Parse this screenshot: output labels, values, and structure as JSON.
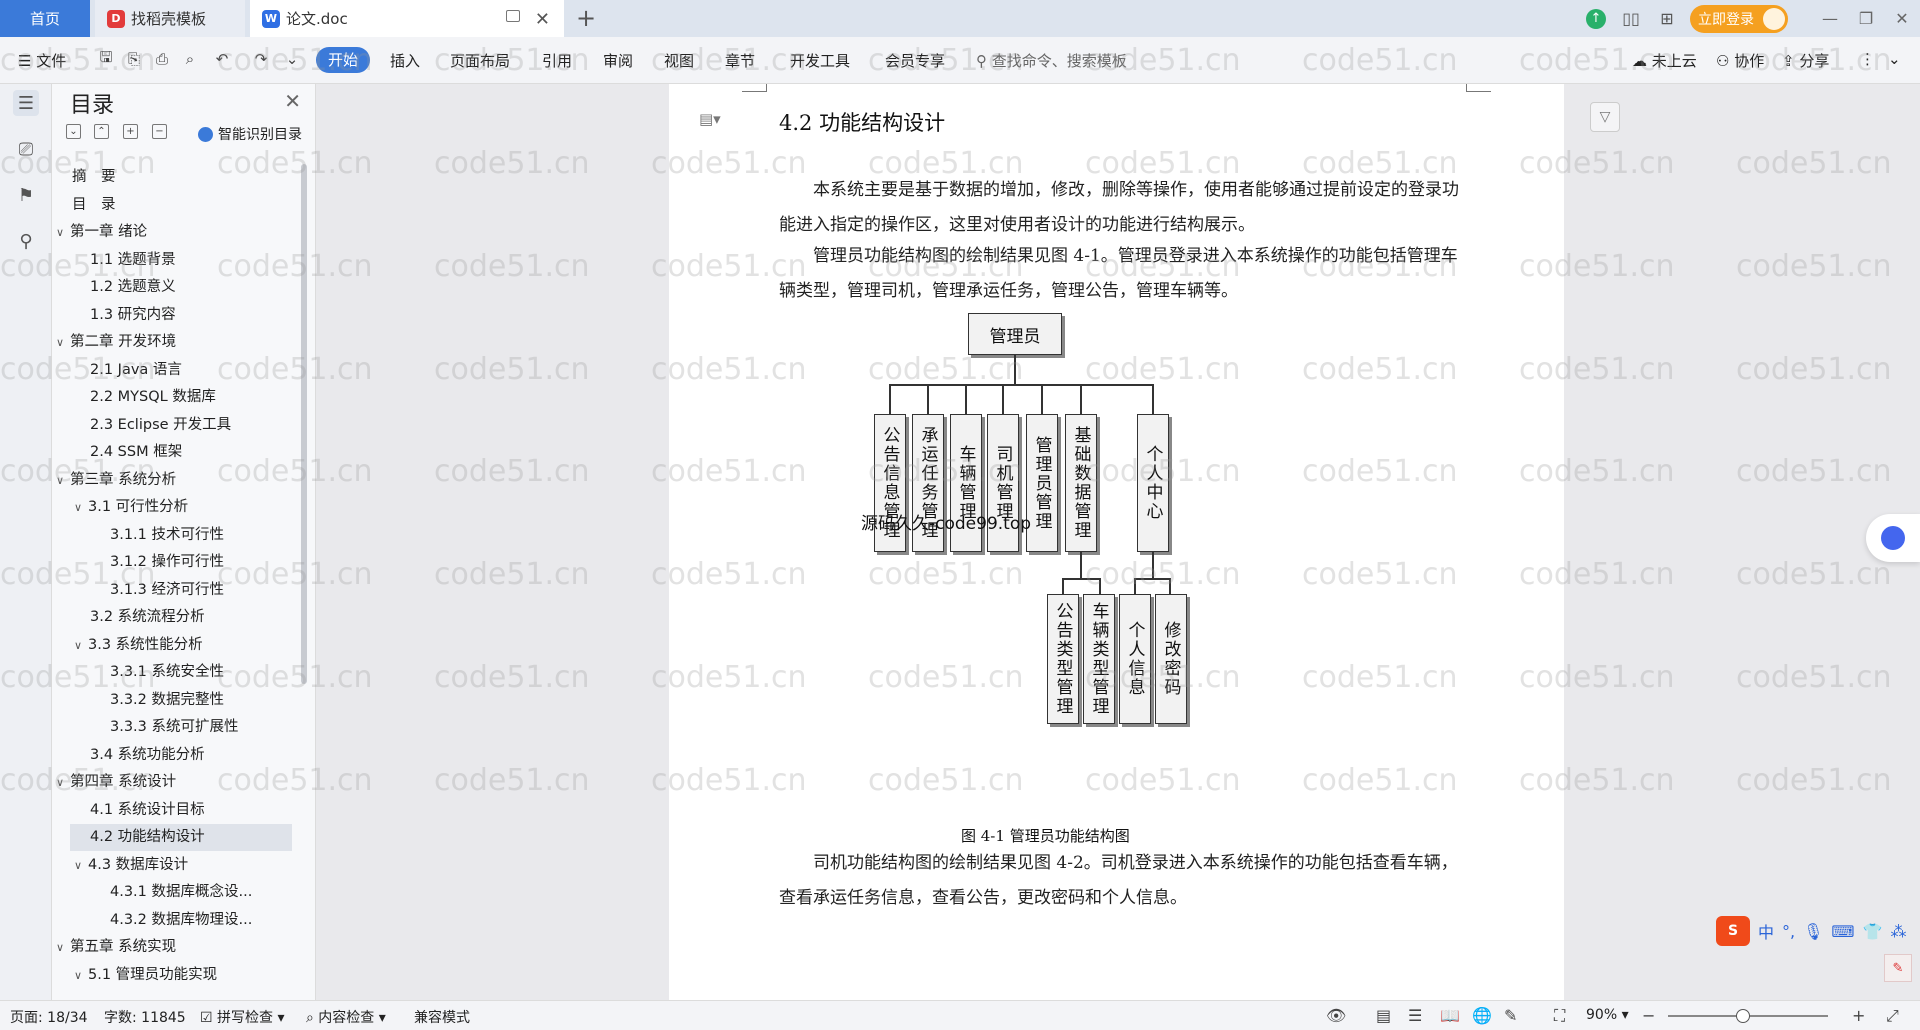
{
  "tabs": {
    "home": "首页",
    "template": "找稻壳模板",
    "doc": "论文.doc"
  },
  "titlebar": {
    "login": "立即登录"
  },
  "menubar": {
    "file": "文件",
    "items": [
      "开始",
      "插入",
      "页面布局",
      "引用",
      "审阅",
      "视图",
      "章节",
      "开发工具",
      "会员专享"
    ],
    "search_placeholder": "查找命令、搜索模板",
    "cloud": "未上云",
    "collab": "协作",
    "share": "分享"
  },
  "toc": {
    "title": "目录",
    "smart": "智能识别目录",
    "items": [
      {
        "text": "摘　要",
        "level": 1,
        "arrow": ""
      },
      {
        "text": "目　录",
        "level": 1,
        "arrow": ""
      },
      {
        "text": "第一章  绪论",
        "level": 1,
        "arrow": "∨"
      },
      {
        "text": "1.1  选题背景",
        "level": 2,
        "arrow": ""
      },
      {
        "text": "1.2  选题意义",
        "level": 2,
        "arrow": ""
      },
      {
        "text": "1.3  研究内容",
        "level": 2,
        "arrow": ""
      },
      {
        "text": "第二章  开发环境",
        "level": 1,
        "arrow": "∨"
      },
      {
        "text": "2.1 Java 语言",
        "level": 2,
        "arrow": ""
      },
      {
        "text": "2.2 MYSQL 数据库",
        "level": 2,
        "arrow": ""
      },
      {
        "text": "2.3 Eclipse 开发工具",
        "level": 2,
        "arrow": ""
      },
      {
        "text": "2.4 SSM 框架",
        "level": 2,
        "arrow": ""
      },
      {
        "text": "第三章  系统分析",
        "level": 1,
        "arrow": "∨"
      },
      {
        "text": "3.1 可行性分析",
        "level": 2,
        "arrow": "∨"
      },
      {
        "text": "3.1.1 技术可行性",
        "level": 3,
        "arrow": ""
      },
      {
        "text": "3.1.2 操作可行性",
        "level": 3,
        "arrow": ""
      },
      {
        "text": "3.1.3 经济可行性",
        "level": 3,
        "arrow": ""
      },
      {
        "text": "3.2 系统流程分析",
        "level": 2,
        "arrow": ""
      },
      {
        "text": "3.3 系统性能分析",
        "level": 2,
        "arrow": "∨"
      },
      {
        "text": "3.3.1 系统安全性",
        "level": 3,
        "arrow": ""
      },
      {
        "text": "3.3.2 数据完整性",
        "level": 3,
        "arrow": ""
      },
      {
        "text": "3.3.3 系统可扩展性",
        "level": 3,
        "arrow": ""
      },
      {
        "text": "3.4 系统功能分析",
        "level": 2,
        "arrow": ""
      },
      {
        "text": "第四章  系统设计",
        "level": 1,
        "arrow": "∨"
      },
      {
        "text": "4.1  系统设计目标",
        "level": 2,
        "arrow": ""
      },
      {
        "text": "4.2 功能结构设计",
        "level": 2,
        "arrow": "",
        "active": true
      },
      {
        "text": "4.3 数据库设计",
        "level": 2,
        "arrow": "∨"
      },
      {
        "text": "4.3.1  数据库概念设...",
        "level": 3,
        "arrow": ""
      },
      {
        "text": "4.3.2  数据库物理设...",
        "level": 3,
        "arrow": ""
      },
      {
        "text": "第五章  系统实现",
        "level": 1,
        "arrow": "∨"
      },
      {
        "text": "5.1 管理员功能实现",
        "level": 2,
        "arrow": "∨"
      }
    ]
  },
  "document": {
    "heading": "4.2 功能结构设计",
    "para1": "本系统主要是基于数据的增加，修改，删除等操作，使用者能够通过提前设定的登录功能进入指定的操作区，这里对使用者设计的功能进行结构展示。",
    "para2": "管理员功能结构图的绘制结果见图 4-1。管理员登录进入本系统操作的功能包括管理车辆类型，管理司机，管理承运任务，管理公告，管理车辆等。",
    "para3": "司机功能结构图的绘制结果见图 4-2。司机登录进入本系统操作的功能包括查看车辆，查看承运任务信息，查看公告，更改密码和个人信息。",
    "overlay": "源码久久-code99.top",
    "chart": {
      "root": "管理员",
      "children": [
        "公告信息管理",
        "承运任务管理",
        "车辆管理",
        "司机管理",
        "管理员管理",
        "基础数据管理",
        "个人中心"
      ],
      "sub_basic": [
        "公告类型管理",
        "车辆类型管理"
      ],
      "sub_personal": [
        "个人信息",
        "修改密码"
      ],
      "caption": "图 4-1  管理员功能结构图"
    }
  },
  "statusbar": {
    "page": "页面: 18/34",
    "words": "字数: 11845",
    "spell": "拼写检查",
    "content_check": "内容检查",
    "compat": "兼容模式",
    "zoom": "90%"
  },
  "watermark": "code51.cn"
}
